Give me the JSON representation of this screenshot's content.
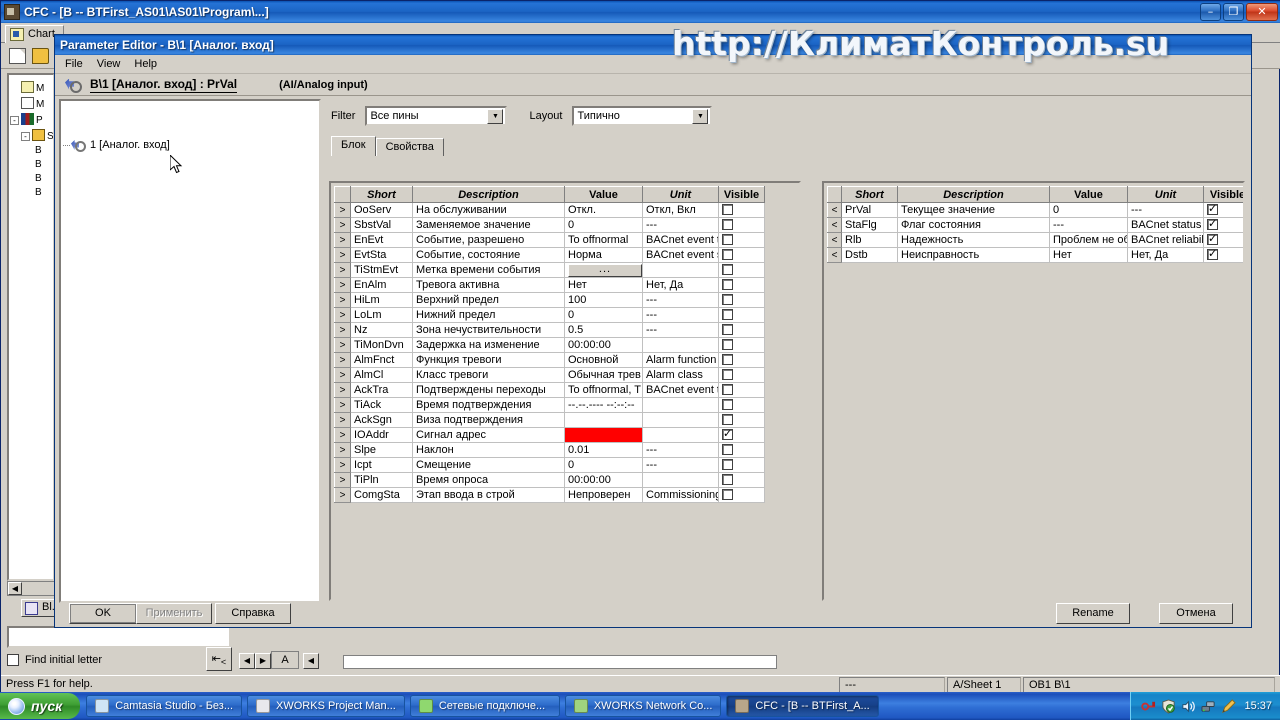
{
  "main_window": {
    "title": "CFC - [B -- BTFirst_AS01\\AS01\\Program\\...]",
    "sysicon_name": "cfc-app-icon",
    "window_buttons": {
      "minimize": "–",
      "restore": "❐",
      "close": "✕"
    },
    "tab_label": "Chart",
    "toolbar": {
      "new": "new-document-icon",
      "open": "open-folder-icon"
    },
    "tree_nodes": [
      {
        "label": "M",
        "icon": "chart-icon"
      },
      {
        "label": "M",
        "icon": "document-icon"
      },
      {
        "label": "P",
        "icon": "books-icon",
        "expander": "-"
      },
      {
        "label": "S",
        "icon": "folder-icon",
        "expander": "-"
      },
      {
        "label": "B",
        "icon": "block-icon"
      },
      {
        "label": "B",
        "icon": "block-icon"
      },
      {
        "label": "B",
        "icon": "block-icon"
      },
      {
        "label": "B",
        "icon": "block-icon"
      }
    ],
    "block_button": "Bl...",
    "find_initial_letter": "Find initial letter",
    "find_checked": false,
    "sort_button": "sort-icon",
    "sheet_tab_label": "A",
    "status": {
      "help_hint": "Press F1 for help.",
      "cell_1": "---",
      "cell_2": "A/Sheet 1",
      "cell_3": "OB1  B\\1"
    }
  },
  "watermark": {
    "text": "http://КлиматКонтроль.su"
  },
  "parameter_editor": {
    "title": "Parameter Editor - B\\1 [Аналог. вход]",
    "menu": [
      "File",
      "View",
      "Help"
    ],
    "header_title": "B\\1 [Аналог. вход] : PrVal",
    "header_subtitle": "(AI/Analog input)",
    "tree_item": "1 [Аналог. вход]",
    "filter_label": "Filter",
    "filter_value": "Все пины",
    "layout_label": "Layout",
    "layout_value": "Типично",
    "tabs": [
      {
        "label": "Блок",
        "active": true
      },
      {
        "label": "Свойства",
        "active": false
      }
    ],
    "columns": [
      "",
      "Short",
      "Description",
      "Value",
      "Unit",
      "Visible"
    ],
    "inputs_table": {
      "rows": [
        {
          "dir": ">",
          "short": "OoServ",
          "description": "На обслуживании",
          "value": "Откл.",
          "unit": "Откл, Вкл",
          "visible": false
        },
        {
          "dir": ">",
          "short": "SbstVal",
          "description": "Заменяемое значение",
          "value": "0",
          "unit": "---",
          "visible": false
        },
        {
          "dir": ">",
          "short": "EnEvt",
          "description": "Событие, разрешено",
          "value": "To offnormal",
          "unit": "BACnet event tr",
          "visible": false
        },
        {
          "dir": ">",
          "short": "EvtSta",
          "description": "Событие, состояние",
          "value": "Норма",
          "unit": "BACnet event s",
          "visible": false
        },
        {
          "dir": ">",
          "short": "TiStmEvt",
          "description": "Метка времени события",
          "value": "...",
          "unit": "",
          "visible": false,
          "value_is_button": true
        },
        {
          "dir": ">",
          "short": "EnAlm",
          "description": "Тревога активна",
          "value": "Нет",
          "unit": "Нет, Да",
          "visible": false
        },
        {
          "dir": ">",
          "short": "HiLm",
          "description": "Верхний предел",
          "value": "100",
          "unit": "---",
          "visible": false
        },
        {
          "dir": ">",
          "short": "LoLm",
          "description": "Нижний предел",
          "value": "0",
          "unit": "---",
          "visible": false
        },
        {
          "dir": ">",
          "short": "Nz",
          "description": "Зона нечуствительности",
          "value": "0.5",
          "unit": "---",
          "visible": false
        },
        {
          "dir": ">",
          "short": "TiMonDvn",
          "description": "Задержка на изменение",
          "value": "00:00:00",
          "unit": "",
          "visible": false
        },
        {
          "dir": ">",
          "short": "AlmFnct",
          "description": "Функция тревоги",
          "value": "Основной",
          "unit": "Alarm function",
          "visible": false
        },
        {
          "dir": ">",
          "short": "AlmCl",
          "description": "Класс тревоги",
          "value": "Обычная трев",
          "unit": "Alarm class",
          "visible": false
        },
        {
          "dir": ">",
          "short": "AckTra",
          "description": "Подтверждены переходы",
          "value": "To offnormal, T",
          "unit": "BACnet event tr",
          "visible": false
        },
        {
          "dir": ">",
          "short": "TiAck",
          "description": "Время подтверждения",
          "value": "--.--.----    --:--:--",
          "unit": "",
          "visible": false
        },
        {
          "dir": ">",
          "short": "AckSgn",
          "description": "Виза подтверждения",
          "value": "",
          "unit": "",
          "visible": false
        },
        {
          "dir": ">",
          "short": "IOAddr",
          "description": "Сигнал адрес",
          "value": "",
          "unit": "",
          "visible": true,
          "value_error": true
        },
        {
          "dir": ">",
          "short": "Slpe",
          "description": "Наклон",
          "value": "0.01",
          "unit": "---",
          "visible": false
        },
        {
          "dir": ">",
          "short": "Icpt",
          "description": "Смещение",
          "value": "0",
          "unit": "---",
          "visible": false
        },
        {
          "dir": ">",
          "short": "TiPln",
          "description": "Время опроса",
          "value": "00:00:00",
          "unit": "",
          "visible": false
        },
        {
          "dir": ">",
          "short": "ComgSta",
          "description": "Этап ввода в строй",
          "value": "Непроверен",
          "unit": "Commissioning",
          "visible": false
        }
      ]
    },
    "outputs_table": {
      "rows": [
        {
          "dir": "<",
          "short": "PrVal",
          "description": "Текущее значение",
          "value": "0",
          "unit": "---",
          "visible": true
        },
        {
          "dir": "<",
          "short": "StaFlg",
          "description": "Флаг состояния",
          "value": "---",
          "unit": "BACnet status f",
          "visible": true
        },
        {
          "dir": "<",
          "short": "Rlb",
          "description": "Надежность",
          "value": "Проблем не об",
          "unit": "BACnet reliabilit",
          "visible": true
        },
        {
          "dir": "<",
          "short": "Dstb",
          "description": "Неисправность",
          "value": "Нет",
          "unit": "Нет, Да",
          "visible": true
        }
      ]
    },
    "buttons": {
      "ok": "OK",
      "apply": "Применить",
      "apply_disabled": true,
      "help": "Справка",
      "rename": "Rename",
      "cancel": "Отмена"
    }
  },
  "taskbar": {
    "start_label": "пуск",
    "items": [
      {
        "label": "Camtasia Studio - Без...",
        "icon": "camtasia-icon",
        "color": "#cfe4f5",
        "active": false
      },
      {
        "label": "XWORKS Project Man...",
        "icon": "xworks-icon",
        "color": "#e8e8ec",
        "active": false
      },
      {
        "label": "Сетевые подключе...",
        "icon": "network-icon",
        "color": "#8fd86f",
        "active": false
      },
      {
        "label": "XWORKS Network Co...",
        "icon": "xworks-network-icon",
        "color": "#9fd47f",
        "active": false
      },
      {
        "label": "CFC - [B -- BTFirst_A...",
        "icon": "cfc-app-icon",
        "color": "#b8a68a",
        "active": true
      }
    ],
    "tray_icons": [
      "key-icon",
      "shield-icon",
      "volume-icon",
      "network-activity-icon",
      "pencil-icon"
    ],
    "clock": "15:37"
  }
}
